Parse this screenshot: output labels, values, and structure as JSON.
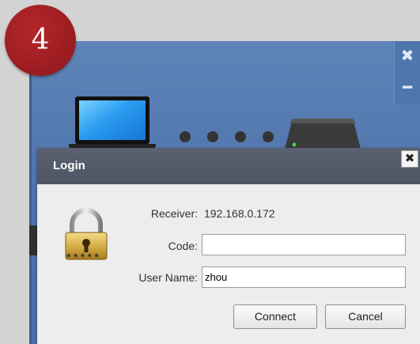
{
  "step_badge": {
    "number": "4"
  },
  "app_window": {
    "close_glyph": "✖",
    "minimize_glyph": "━"
  },
  "login_dialog": {
    "title": "Login",
    "close_glyph": "✖",
    "lock_caption": "*****",
    "receiver": {
      "label": "Receiver:",
      "value": "192.168.0.172"
    },
    "code": {
      "label": "Code:",
      "value": ""
    },
    "user_name": {
      "label": "User Name:",
      "value": "zhou"
    },
    "connect_label": "Connect",
    "cancel_label": "Cancel"
  },
  "icons": {
    "lock": "lock-icon",
    "laptop": "laptop-icon",
    "receiver": "receiver-icon"
  },
  "colors": {
    "app_blue": "#5f84b8",
    "dialog_titlebar": "#5a6170",
    "badge_red": "#9a1c20"
  }
}
